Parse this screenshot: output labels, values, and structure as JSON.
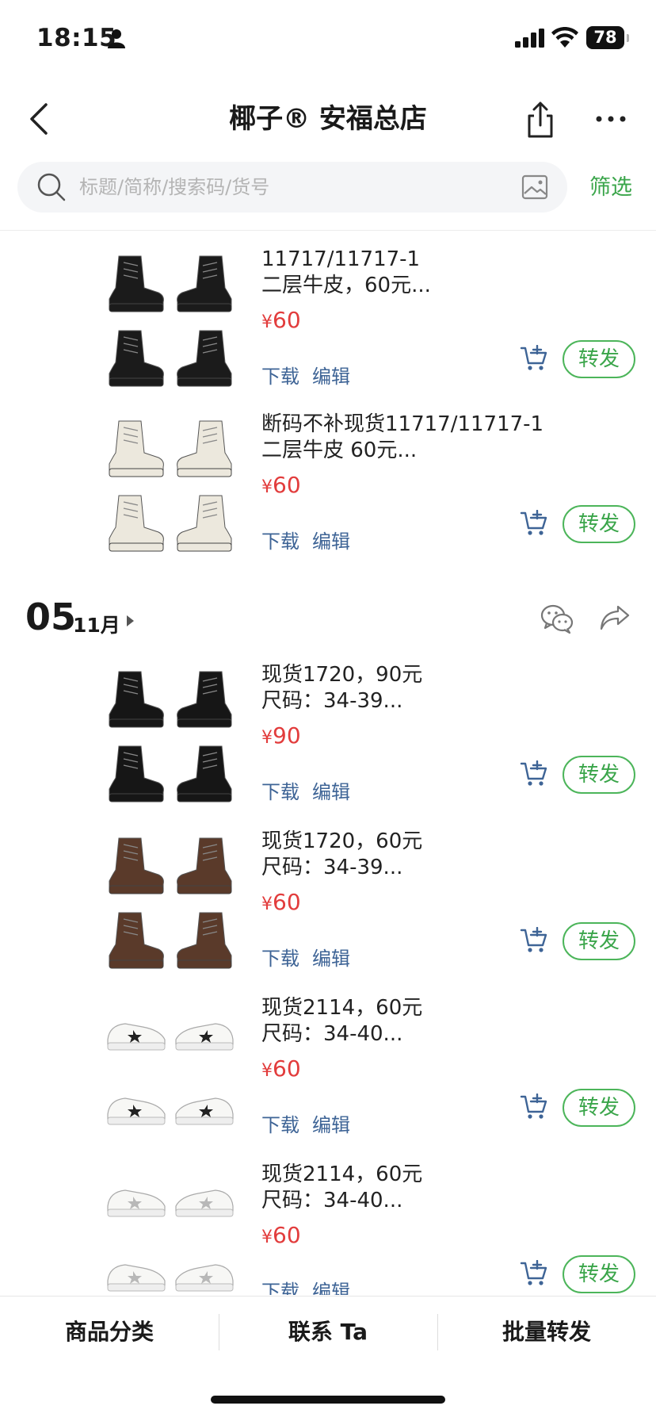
{
  "status_bar": {
    "time": "18:15",
    "battery": "78"
  },
  "nav": {
    "title": "椰子® 安福总店"
  },
  "search": {
    "placeholder": "标题/简称/搜索码/货号",
    "filter_label": "筛选"
  },
  "product_actions": {
    "download": "下载",
    "edit": "编辑",
    "forward": "转发"
  },
  "products_top": [
    {
      "title_line1": "11717/11717-1",
      "title_line2": "二层牛皮，60元...",
      "price": "60",
      "thumb_color": "black"
    },
    {
      "title_line1": "断码不补现货11717/11717-1",
      "title_line2": "二层牛皮 60元...",
      "price": "60",
      "thumb_color": "white"
    }
  ],
  "date_group": {
    "day": "05",
    "month": "11月"
  },
  "products_group": [
    {
      "title_line1": "现货1720，90元",
      "title_line2": "尺码：34-39...",
      "price": "90",
      "thumb_color": "black"
    },
    {
      "title_line1": "现货1720，60元",
      "title_line2": "尺码：34-39...",
      "price": "60",
      "thumb_color": "brown"
    },
    {
      "title_line1": "现货2114，60元",
      "title_line2": "尺码：34-40...",
      "price": "60",
      "thumb_color": "sneaker-black"
    },
    {
      "title_line1": "现货2114，60元",
      "title_line2": "尺码：34-40...",
      "price": "60",
      "thumb_color": "sneaker-silver"
    }
  ],
  "currency_symbol": "¥",
  "bottom_tabs": {
    "categories": "商品分类",
    "contact": "联系 Ta",
    "batch_forward": "批量转发"
  },
  "colors": {
    "accent_green": "#3aa54a",
    "price_red": "#e23c3c",
    "link_blue": "#3e6496"
  }
}
